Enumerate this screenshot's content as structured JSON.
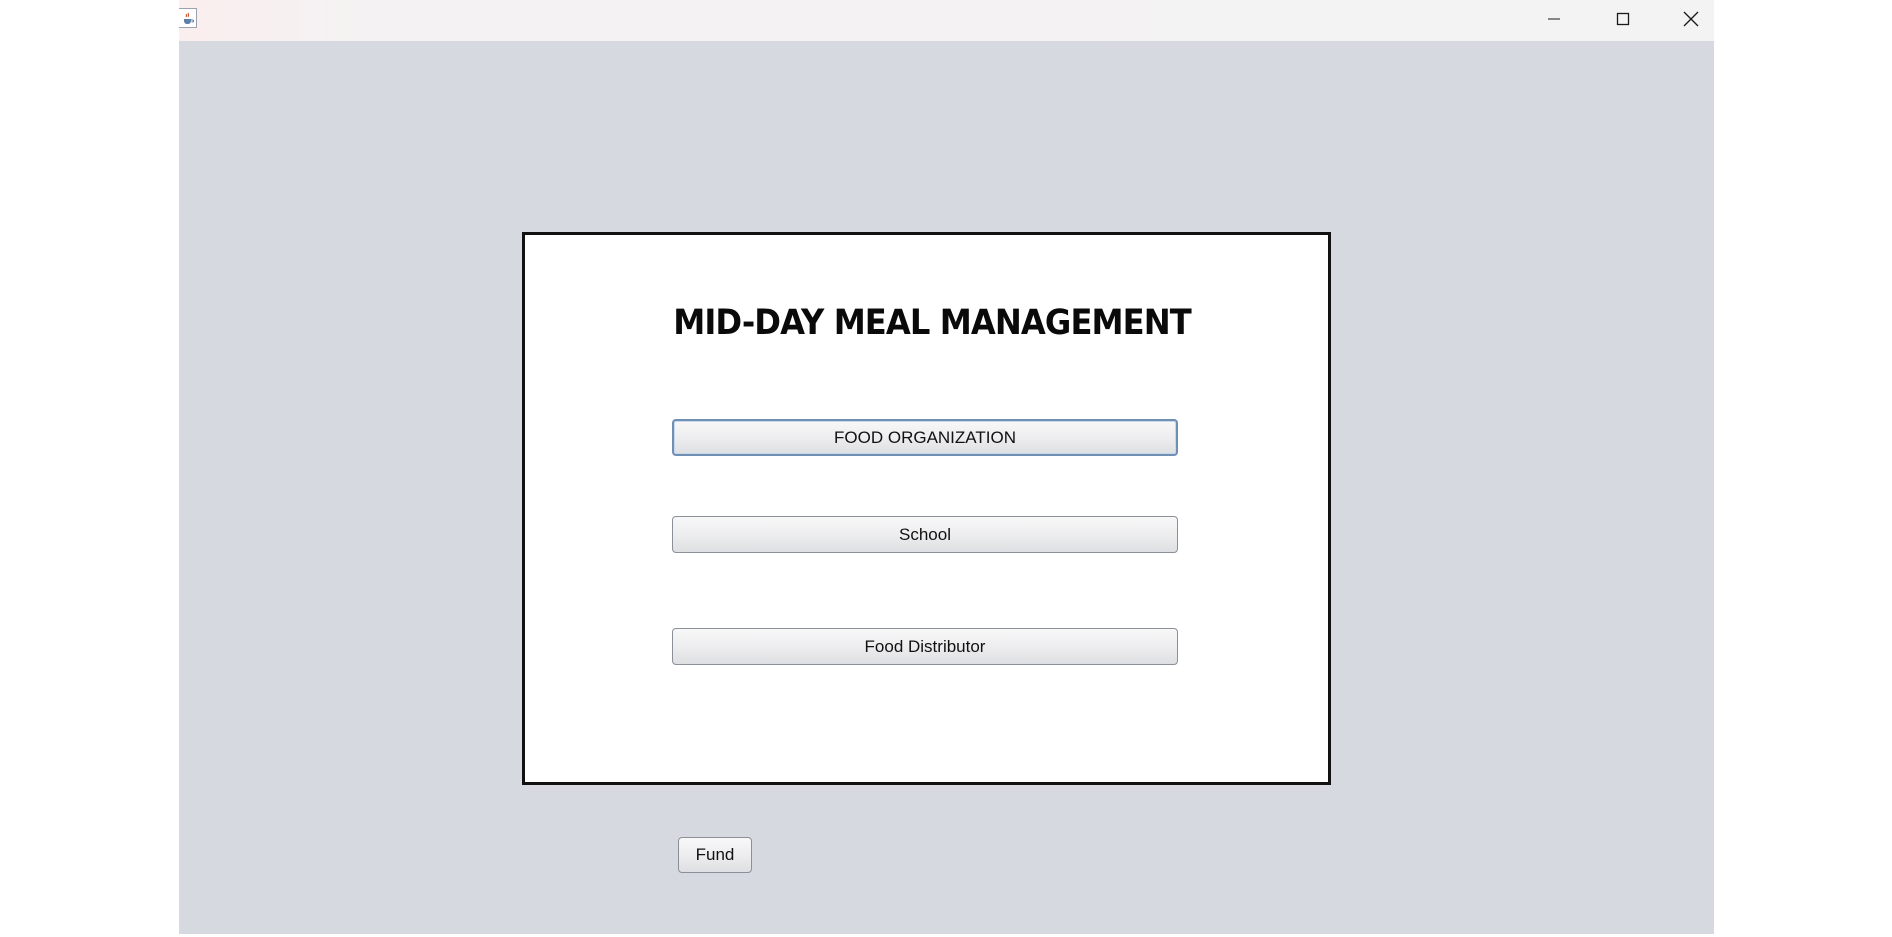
{
  "window": {
    "app_icon": "java-cup-icon",
    "controls": {
      "minimize": "minimize-icon",
      "maximize": "maximize-icon",
      "close": "close-icon"
    }
  },
  "panel": {
    "title": "MID-DAY MEAL MANAGEMENT",
    "buttons": [
      {
        "label": "FOOD ORGANIZATION"
      },
      {
        "label": "School"
      },
      {
        "label": "Food Distributor"
      }
    ]
  },
  "fund_button": {
    "label": "Fund"
  },
  "colors": {
    "background": "#d6d9e0",
    "panel": "#ffffff",
    "border": "#111111",
    "focus": "#6f8fb5"
  }
}
